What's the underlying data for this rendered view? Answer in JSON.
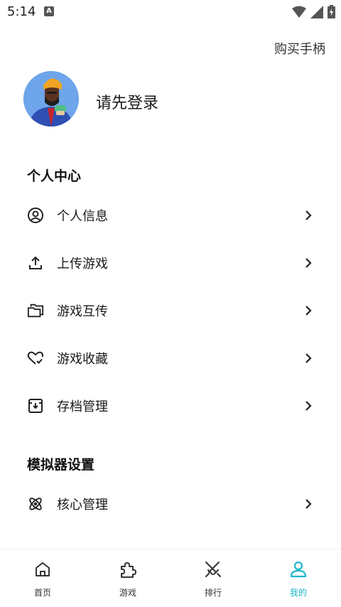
{
  "status_bar": {
    "time": "5:14",
    "notification_letter": "A"
  },
  "header": {
    "buy_link": "购买手柄"
  },
  "profile": {
    "login_prompt": "请先登录"
  },
  "personal_center": {
    "title": "个人中心",
    "items": [
      {
        "label": "个人信息",
        "icon": "user-circle-icon"
      },
      {
        "label": "上传游戏",
        "icon": "upload-icon"
      },
      {
        "label": "游戏互传",
        "icon": "folder-icon"
      },
      {
        "label": "游戏收藏",
        "icon": "heart-check-icon"
      },
      {
        "label": "存档管理",
        "icon": "archive-icon"
      }
    ]
  },
  "emulator_settings": {
    "title": "模拟器设置",
    "items": [
      {
        "label": "核心管理",
        "icon": "atom-icon"
      }
    ]
  },
  "bottom_nav": {
    "active_color": "#1fb8c9",
    "items": [
      {
        "label": "首页",
        "icon": "home-icon"
      },
      {
        "label": "游戏",
        "icon": "puzzle-icon"
      },
      {
        "label": "排行",
        "icon": "crossed-swords-icon"
      },
      {
        "label": "我的",
        "icon": "profile-icon"
      }
    ]
  }
}
